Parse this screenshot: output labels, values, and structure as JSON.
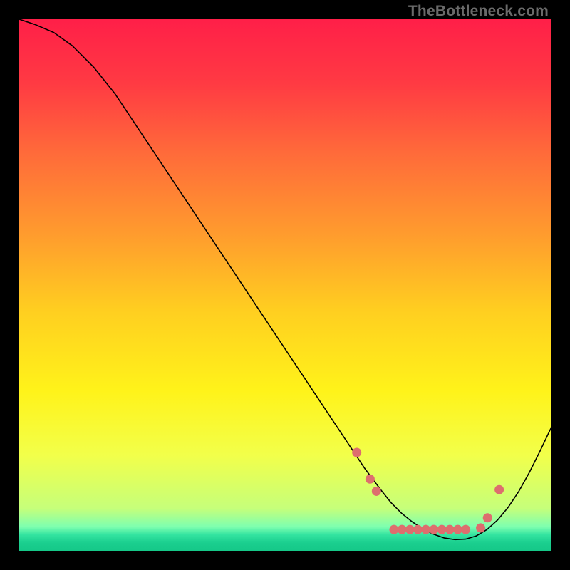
{
  "watermark": "TheBottleneck.com",
  "chart_data": {
    "type": "line",
    "title": "",
    "xlabel": "",
    "ylabel": "",
    "xlim": [
      0,
      100
    ],
    "ylim": [
      0,
      100
    ],
    "grid": false,
    "legend": false,
    "background_gradient": {
      "stops": [
        {
          "offset": 0.0,
          "color": "#ff1f48"
        },
        {
          "offset": 0.12,
          "color": "#ff3a43"
        },
        {
          "offset": 0.25,
          "color": "#ff6a3a"
        },
        {
          "offset": 0.4,
          "color": "#ff9a2e"
        },
        {
          "offset": 0.55,
          "color": "#ffcf20"
        },
        {
          "offset": 0.7,
          "color": "#fff31a"
        },
        {
          "offset": 0.82,
          "color": "#f2ff4a"
        },
        {
          "offset": 0.92,
          "color": "#c6ff7a"
        },
        {
          "offset": 0.955,
          "color": "#7dffb0"
        },
        {
          "offset": 0.97,
          "color": "#33e3a0"
        },
        {
          "offset": 0.985,
          "color": "#1bcf8f"
        },
        {
          "offset": 1.0,
          "color": "#15c888"
        }
      ]
    },
    "series": [
      {
        "name": "bottleneck-curve",
        "stroke": "#000000",
        "stroke_width": 1.6,
        "x": [
          0,
          3,
          6.5,
          10,
          14,
          18,
          24,
          30,
          36,
          42,
          48,
          54,
          58,
          62,
          65,
          68,
          70,
          72,
          74,
          76,
          78,
          80,
          82,
          84,
          86,
          88,
          90,
          92,
          94,
          96,
          98,
          100
        ],
        "y": [
          100,
          99,
          97.5,
          95,
          91,
          86,
          77,
          68,
          59,
          50,
          41,
          32,
          26,
          20,
          15.5,
          11.5,
          9,
          7,
          5.4,
          4.1,
          3.1,
          2.4,
          2.1,
          2.2,
          2.8,
          4.0,
          5.8,
          8.2,
          11.2,
          14.8,
          18.8,
          23
        ]
      }
    ],
    "markers": {
      "color": "#dd6e6e",
      "radius": 6.5,
      "points": [
        {
          "x": 63.5,
          "y": 18.5
        },
        {
          "x": 66.0,
          "y": 13.5
        },
        {
          "x": 67.2,
          "y": 11.2
        },
        {
          "x": 70.5,
          "y": 4.0
        },
        {
          "x": 72.0,
          "y": 4.0
        },
        {
          "x": 73.5,
          "y": 4.0
        },
        {
          "x": 75.0,
          "y": 4.0
        },
        {
          "x": 76.5,
          "y": 4.0
        },
        {
          "x": 78.0,
          "y": 4.0
        },
        {
          "x": 79.5,
          "y": 4.0
        },
        {
          "x": 81.0,
          "y": 4.0
        },
        {
          "x": 82.5,
          "y": 4.0
        },
        {
          "x": 84.0,
          "y": 4.0
        },
        {
          "x": 86.8,
          "y": 4.3
        },
        {
          "x": 88.1,
          "y": 6.2
        },
        {
          "x": 90.3,
          "y": 11.5
        }
      ]
    }
  }
}
